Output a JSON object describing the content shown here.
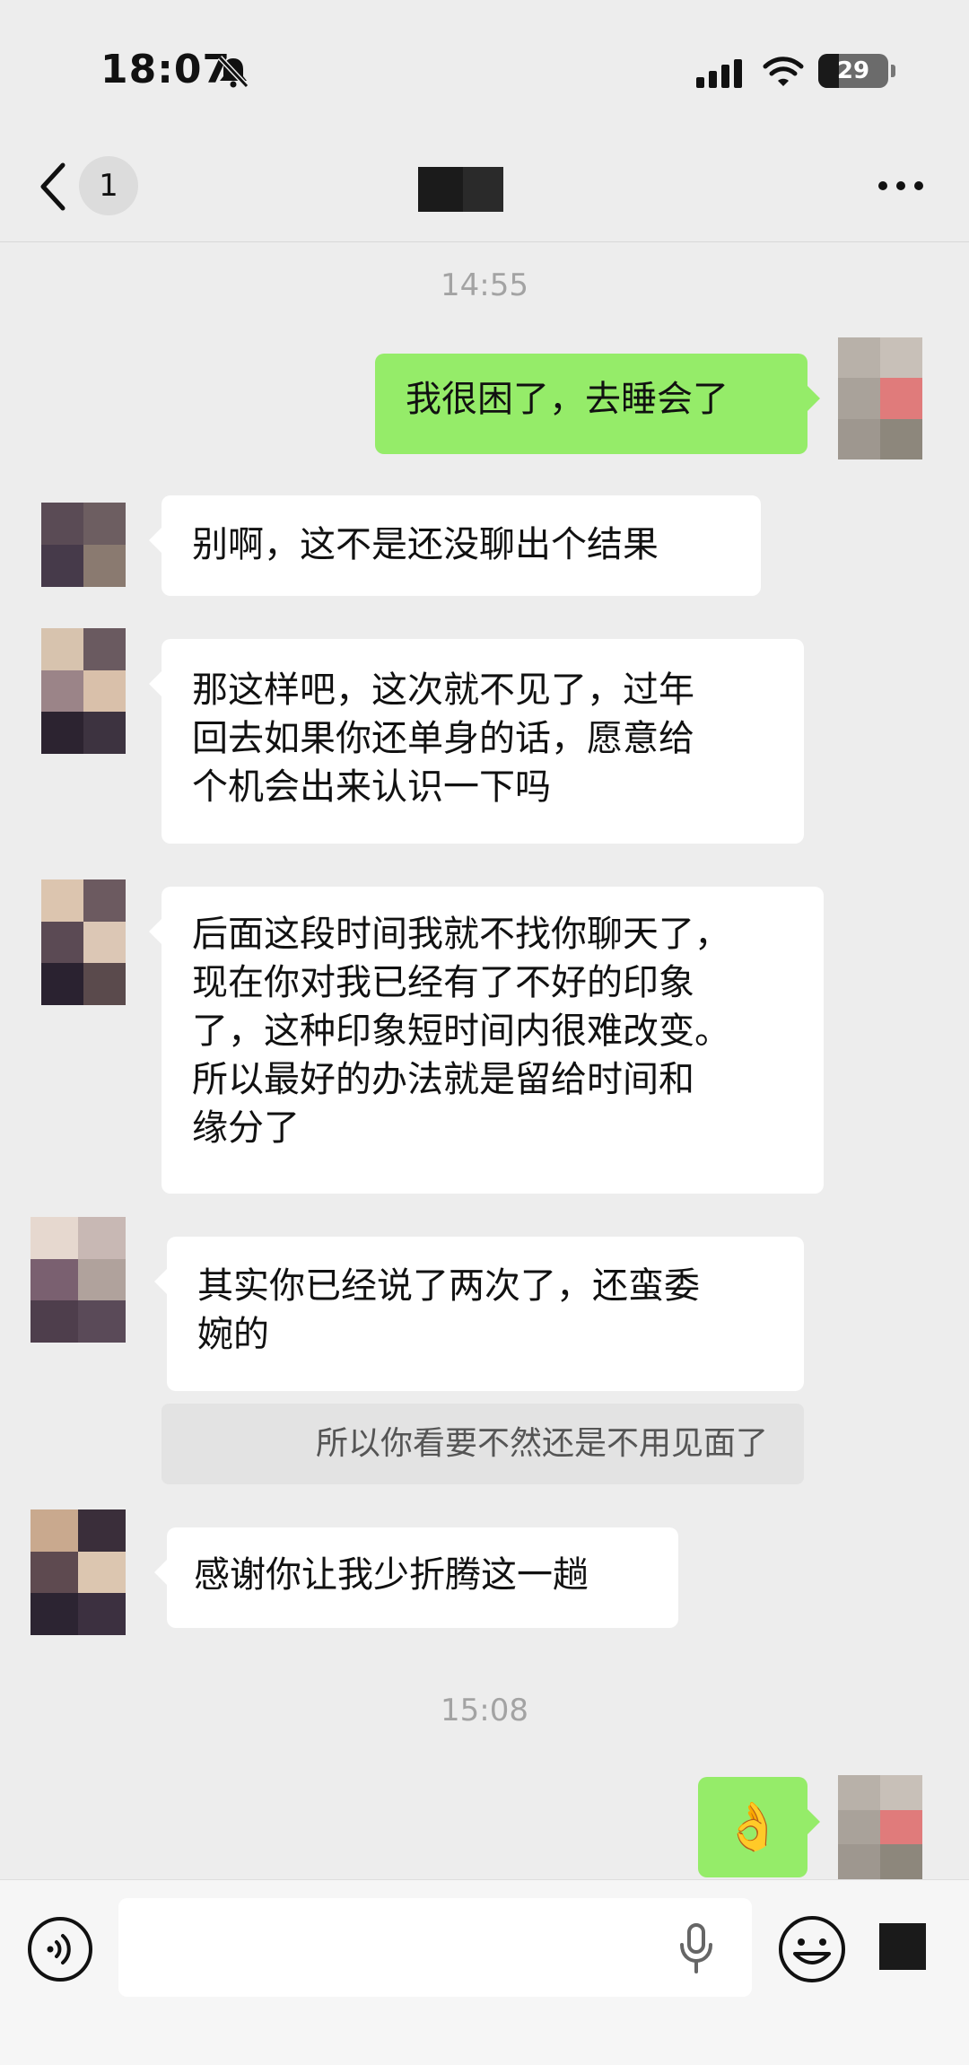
{
  "status_bar": {
    "time": "18:07",
    "battery": "29",
    "battery_level": 0.29
  },
  "nav": {
    "unread_count": "1"
  },
  "chat": {
    "timestamp_1": "14:55",
    "timestamp_2": "15:08",
    "messages": [
      {
        "side": "out",
        "text": "我很困了，去睡会了"
      },
      {
        "side": "in",
        "text": "别啊，这不是还没聊出个结果"
      },
      {
        "side": "in",
        "lines": [
          "那这样吧，这次就不见了，过年",
          "回去如果你还单身的话，愿意给",
          "个机会出来认识一下吗"
        ]
      },
      {
        "side": "in",
        "lines": [
          "后面这段时间我就不找你聊天了，",
          "现在你对我已经有了不好的印象",
          "了，这种印象短时间内很难改变。",
          "所以最好的办法就是留给时间和",
          "缘分了"
        ]
      },
      {
        "side": "in",
        "lines": [
          "其实你已经说了两次了，还蛮委",
          "婉的"
        ]
      },
      {
        "side": "in",
        "text": "感谢你让我少折腾这一趟"
      },
      {
        "side": "out",
        "emoji": "👌"
      }
    ],
    "quote": "所以你看要不然还是不用见面了"
  },
  "colors": {
    "background": "#ededed",
    "bubble_out": "#95ec69",
    "bubble_in": "#ffffff",
    "timestamp": "#a3a3a3"
  },
  "icons": {
    "status": [
      "bell-muted-icon",
      "signal-icon",
      "wifi-icon",
      "battery-icon"
    ],
    "nav": [
      "back-chevron-icon",
      "more-icon"
    ],
    "input": [
      "voice-icon",
      "mic-icon",
      "emoji-icon",
      "plus-icon"
    ]
  }
}
